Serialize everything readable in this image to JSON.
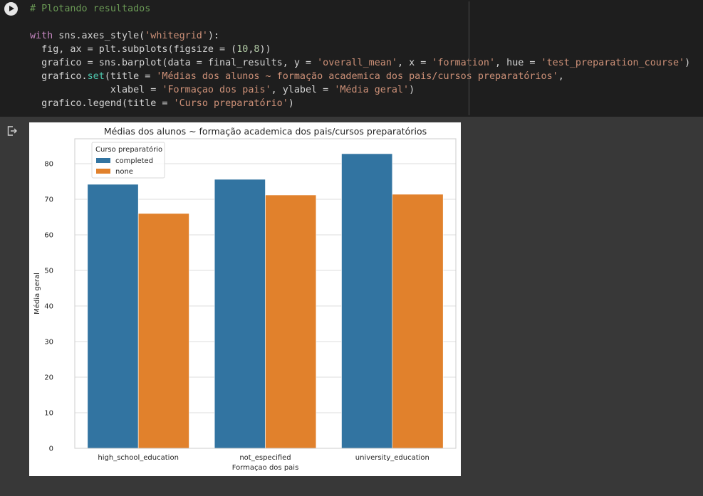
{
  "code_cell": {
    "lines": [
      [
        {
          "t": "# Plotando resultados",
          "c": "cm"
        }
      ],
      [],
      [
        {
          "t": "with",
          "c": "kw"
        },
        {
          "t": " sns.axes_style("
        },
        {
          "t": "'whitegrid'",
          "c": "str"
        },
        {
          "t": "):"
        }
      ],
      [
        {
          "t": "  fig, ax = plt.subplots(figsize = ("
        },
        {
          "t": "10",
          "c": "num"
        },
        {
          "t": ","
        },
        {
          "t": "8",
          "c": "num"
        },
        {
          "t": "))"
        }
      ],
      [
        {
          "t": "  grafico = sns.barplot(data = final_results, y = "
        },
        {
          "t": "'overall_mean'",
          "c": "str"
        },
        {
          "t": ", x = "
        },
        {
          "t": "'formation'",
          "c": "str"
        },
        {
          "t": ", hue = "
        },
        {
          "t": "'test_preparation_course'",
          "c": "str"
        },
        {
          "t": ")"
        }
      ],
      [
        {
          "t": "  grafico."
        },
        {
          "t": "set",
          "c": "fn"
        },
        {
          "t": "(title = "
        },
        {
          "t": "'Médias dos alunos ~ formação academica dos pais/cursos preparatórios'",
          "c": "str"
        },
        {
          "t": ","
        }
      ],
      [
        {
          "t": "              xlabel = "
        },
        {
          "t": "'Formaçao dos pais'",
          "c": "str"
        },
        {
          "t": ", ylabel = "
        },
        {
          "t": "'Média geral'",
          "c": "str"
        },
        {
          "t": ")"
        }
      ],
      [
        {
          "t": "  grafico.legend(title = "
        },
        {
          "t": "'Curso preparatório'",
          "c": "str"
        },
        {
          "t": ")"
        }
      ]
    ]
  },
  "chart_data": {
    "type": "bar",
    "title": "Médias dos alunos ~ formação academica dos pais/cursos preparatórios",
    "xlabel": "Formaçao dos pais",
    "ylabel": "Média geral",
    "categories": [
      "high_school_education",
      "not_especified",
      "university_education"
    ],
    "series": [
      {
        "name": "completed",
        "values": [
          74.2,
          75.6,
          82.8
        ],
        "color": "#3274a1"
      },
      {
        "name": "none",
        "values": [
          66.0,
          71.2,
          71.4
        ],
        "color": "#e1812c"
      }
    ],
    "ylim": [
      0,
      87
    ],
    "yticks": [
      0,
      10,
      20,
      30,
      40,
      50,
      60,
      70,
      80
    ],
    "grid": true,
    "legend": {
      "title": "Curso preparatório",
      "placement": "top-left"
    }
  }
}
